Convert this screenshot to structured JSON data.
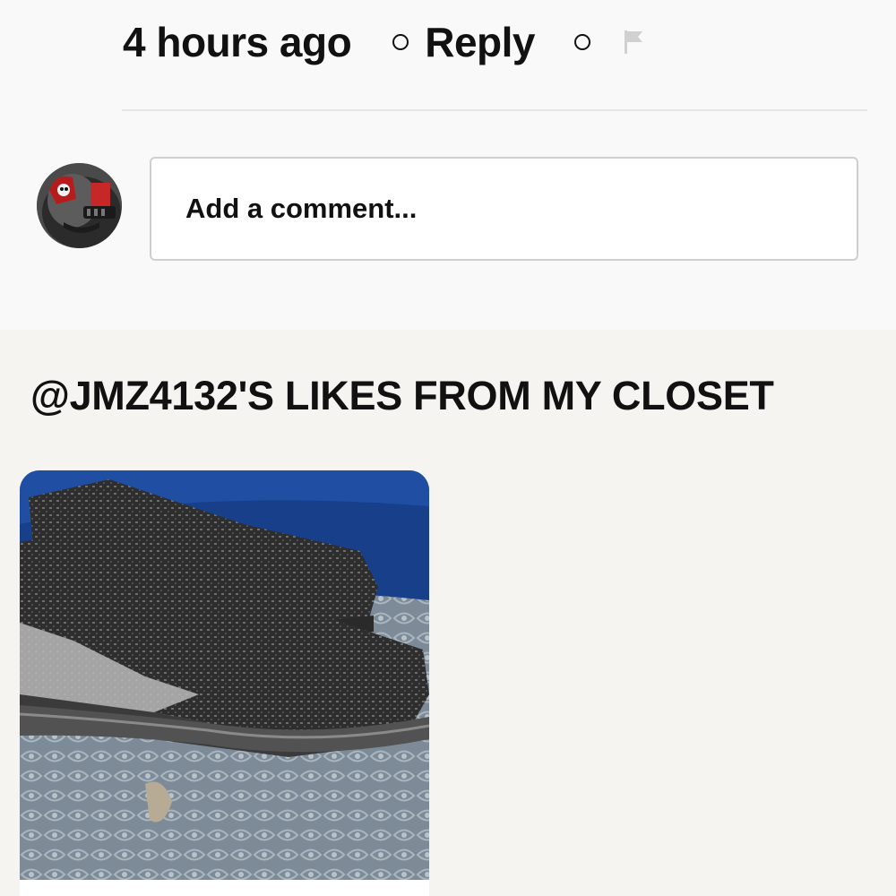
{
  "comment_meta": {
    "time_ago": "4 hours ago",
    "reply_label": "Reply",
    "icons": [
      "separator-dot",
      "separator-dot",
      "flag-icon"
    ]
  },
  "add_comment": {
    "placeholder": "Add a comment..."
  },
  "likes": {
    "heading": "@JMZ4132'S LIKES FROM MY CLOSET",
    "items": [
      {
        "image": "black knit sneaker listing photo"
      }
    ]
  },
  "colors": {
    "page_bg": "#f9f9f9",
    "section_bg": "#f5f4f1",
    "text": "#111111",
    "border": "#cfcfcf",
    "flag": "#d0d0d0"
  }
}
